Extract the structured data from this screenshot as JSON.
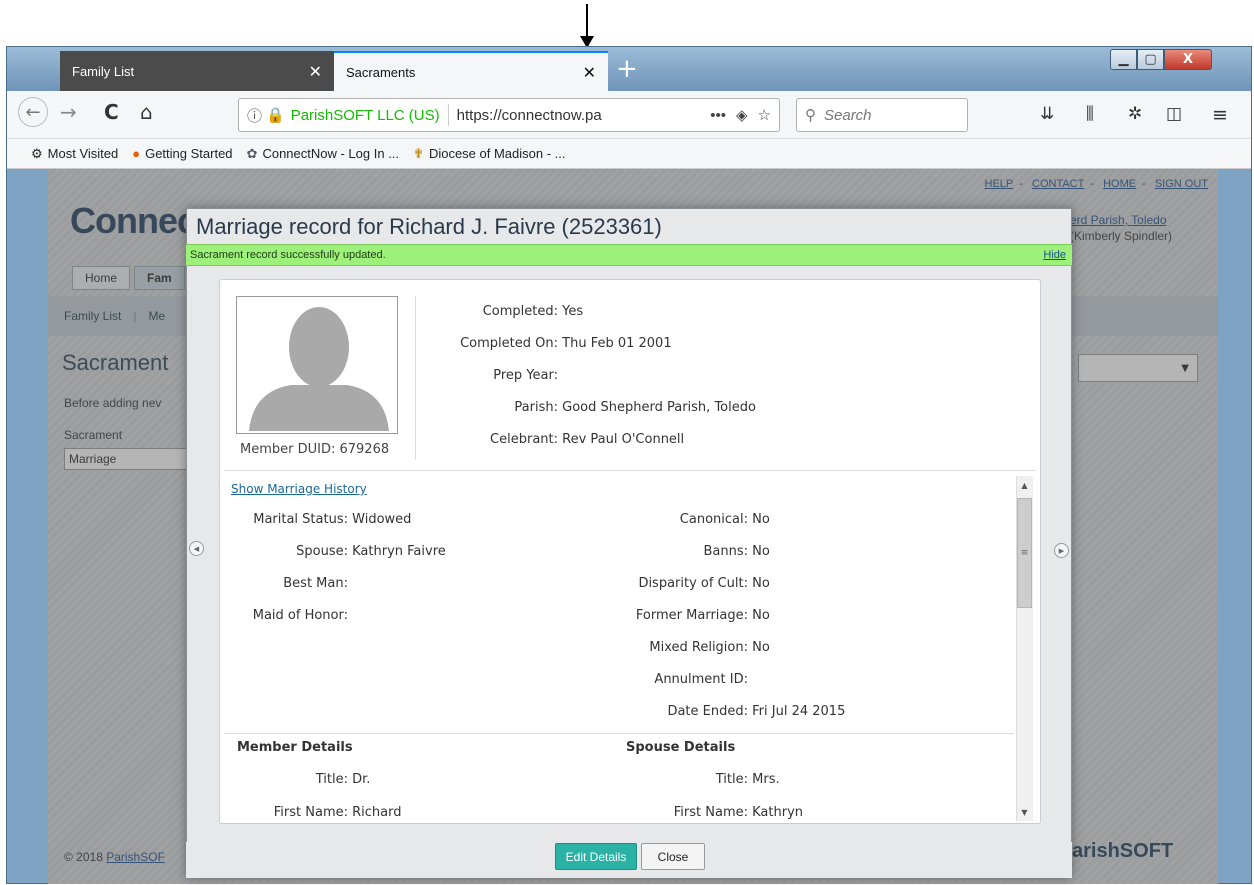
{
  "browser": {
    "tabs": [
      {
        "label": "Family List",
        "close": "✕"
      },
      {
        "label": "Sacraments",
        "close": "✕"
      }
    ],
    "new_tab": "+",
    "window_controls": {
      "minimize": "▁",
      "maximize": "▢",
      "close": "X"
    },
    "nav": {
      "back": "←",
      "forward": "→",
      "reload": "C",
      "home": "⌂"
    },
    "urlbar": {
      "site_identity": "ParishSOFT LLC (US)",
      "url": "https://connectnow.pa",
      "more": "•••",
      "pocket": "◈",
      "bookmark": "☆"
    },
    "search_placeholder": "Search",
    "toolbar_icons": [
      "library-icon",
      "sync-icon",
      "sidebar-icon",
      "menu-icon"
    ],
    "bookmarks": [
      {
        "icon": "⚙",
        "label": "Most Visited"
      },
      {
        "icon": "●",
        "label": "Getting Started"
      },
      {
        "icon": "✿",
        "label": "ConnectNow - Log In ..."
      },
      {
        "icon": "✟",
        "label": "Diocese of Madison - ..."
      }
    ]
  },
  "app": {
    "top_links": [
      "HELP",
      "CONTACT",
      "HOME",
      "SIGN OUT"
    ],
    "logo": "Connec",
    "parish_line1": "erd Parish, Toledo",
    "parish_line2": "(Kimberly Spindler)",
    "nav_tabs": [
      "Home",
      "Fam"
    ],
    "subnav": [
      "Family List",
      "Me"
    ],
    "page_title": "Sacrament",
    "intro_text": "Before adding nev",
    "sacrament_label": "Sacrament",
    "sacrament_value": "Marriage",
    "footer_text": "© 2018",
    "footer_link": "ParishSOF",
    "footer_logo": "arishSOFT"
  },
  "modal": {
    "title": "Marriage record for Richard J. Faivre (2523361)",
    "banner": "Sacrament record successfully updated.",
    "banner_hide": "Hide",
    "member_duid": "Member DUID: 679268",
    "summary": [
      {
        "label": "Completed:",
        "value": "Yes"
      },
      {
        "label": "Completed On:",
        "value": "Thu Feb 01 2001"
      },
      {
        "label": "Prep Year:",
        "value": ""
      },
      {
        "label": "Parish:",
        "value": "Good Shepherd Parish, Toledo"
      },
      {
        "label": "Celebrant:",
        "value": "Rev Paul O'Connell"
      }
    ],
    "show_history": "Show Marriage History",
    "left_details": [
      {
        "label": "Marital Status:",
        "value": "Widowed"
      },
      {
        "label": "Spouse:",
        "value": "Kathryn Faivre"
      },
      {
        "label": "Best Man:",
        "value": ""
      },
      {
        "label": "Maid of Honor:",
        "value": ""
      }
    ],
    "right_details": [
      {
        "label": "Canonical:",
        "value": "No"
      },
      {
        "label": "Banns:",
        "value": "No"
      },
      {
        "label": "Disparity of Cult:",
        "value": "No"
      },
      {
        "label": "Former Marriage:",
        "value": "No"
      },
      {
        "label": "Mixed Religion:",
        "value": "No"
      },
      {
        "label": "Annulment ID:",
        "value": ""
      },
      {
        "label": "Date Ended:",
        "value": "Fri Jul 24 2015"
      }
    ],
    "member_details_heading": "Member Details",
    "spouse_details_heading": "Spouse Details",
    "member_title_label": "Title:",
    "member_title": "Dr.",
    "member_first_label": "First Name:",
    "member_first": "Richard",
    "spouse_title_label": "Title:",
    "spouse_title": "Mrs.",
    "spouse_first_label": "First Name:",
    "spouse_first": "Kathryn",
    "buttons": {
      "edit": "Edit Details",
      "close": "Close"
    }
  }
}
